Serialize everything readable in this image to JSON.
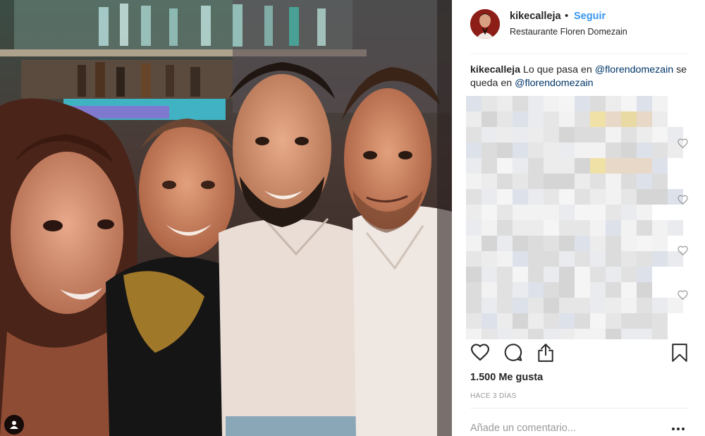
{
  "post": {
    "username": "kikecalleja",
    "separator": "•",
    "follow_label": "Seguir",
    "location": "Restaurante Floren Domezain",
    "caption": {
      "user": "kikecalleja",
      "text_before": " Lo que pasa en ",
      "mention_1": "@florendomezain",
      "text_middle": " se queda en ",
      "mention_2": "@florendomezain"
    },
    "likes": "1.500 Me gusta",
    "time_ago": "HACE 3 DÍAS",
    "comment_placeholder": "Añade un comentario..."
  },
  "icons": {
    "like": "heart-icon",
    "comment": "comment-bubble-icon",
    "share": "share-icon",
    "save": "bookmark-icon",
    "more": "more-options-icon",
    "tag": "user-tag-icon",
    "comment_like": "heart-outline-icon"
  },
  "colors": {
    "link_blue": "#3897f0",
    "mention_blue": "#003569",
    "text": "#262626",
    "muted": "#999999",
    "divider": "#efefef"
  }
}
